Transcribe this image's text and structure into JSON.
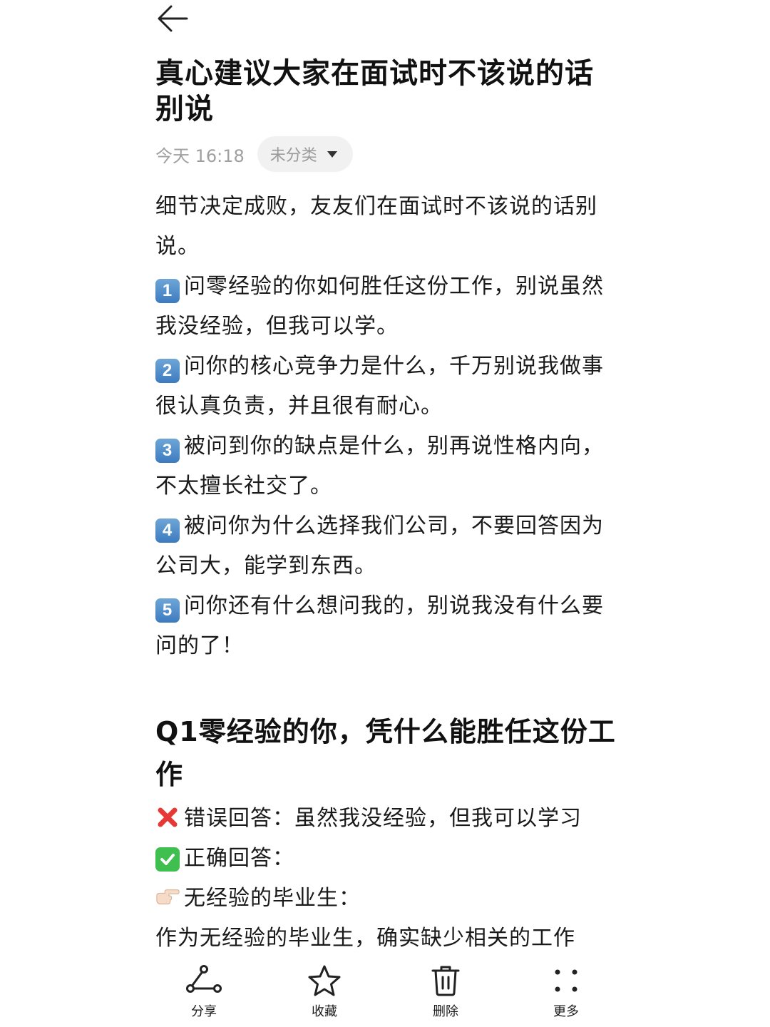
{
  "note": {
    "title": "真心建议大家在面试时不该说的话别说",
    "time": "今天 16:18",
    "category": "未分类",
    "intro": "细节决定成败，友友们在面试时不该说的话别说。",
    "points": [
      {
        "num": "1",
        "text": "问零经验的你如何胜任这份工作，别说虽然我没经验，但我可以学。"
      },
      {
        "num": "2",
        "text": "问你的核心竞争力是什么，千万别说我做事很认真负责，并且很有耐心。"
      },
      {
        "num": "3",
        "text": "被问到你的缺点是什么，别再说性格内向，不太擅长社交了。"
      },
      {
        "num": "4",
        "text": "被问你为什么选择我们公司，不要回答因为公司大，能学到东西。"
      },
      {
        "num": "5",
        "text": "问你还有什么想问我的，别说我没有什么要问的了！"
      }
    ],
    "section_title": "Q1零经验的你，凭什么能胜任这份工作",
    "wrong_answer": "错误回答：虽然我没经验，但我可以学习",
    "right_answer": "正确回答：",
    "pointer_line": "无经验的毕业生：",
    "last_line": "作为无经验的毕业生，确实缺少相关的工作"
  },
  "icons": {
    "back": "back-arrow-icon",
    "chip": "dropdown-triangle-icon",
    "wrong": "red-cross-icon",
    "right": "green-check-icon",
    "pointer": "pointing-hand-icon"
  },
  "bottom_bar": {
    "share": "分享",
    "favorite": "收藏",
    "delete": "删除",
    "more": "更多"
  },
  "colors": {
    "badge": "#4a88c8",
    "check": "#3fbf4f",
    "cross": "#e53935",
    "chip_bg": "#f1f1f1",
    "muted": "#a0a0a0"
  }
}
